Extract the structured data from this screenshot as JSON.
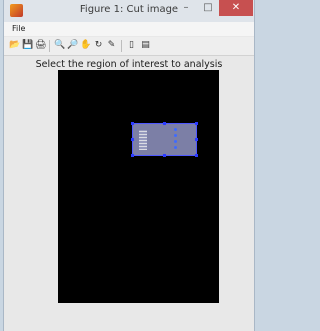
{
  "window": {
    "title": "Figure 1: Cut image",
    "controls": {
      "minimize": "–",
      "maximize": "□",
      "close": "✕"
    }
  },
  "menu": {
    "items": [
      "File"
    ]
  },
  "toolbar": {
    "icons": [
      "open-file-icon",
      "save-icon",
      "print-icon",
      "zoom-in-icon",
      "zoom-out-icon",
      "pan-icon",
      "rotate-3d-icon",
      "data-cursor-icon",
      "colorbar-icon",
      "legend-icon"
    ],
    "glyphs": [
      "📂",
      "💾",
      "🖨",
      "🔍",
      "🔎",
      "✋",
      "↻",
      "✎",
      "▯",
      "▤"
    ]
  },
  "figure": {
    "prompt": "Select the region of interest to analysis"
  },
  "colors": {
    "axes_background": "#000000",
    "roi_border": "#4f58ff",
    "close_button": "#c75050"
  }
}
